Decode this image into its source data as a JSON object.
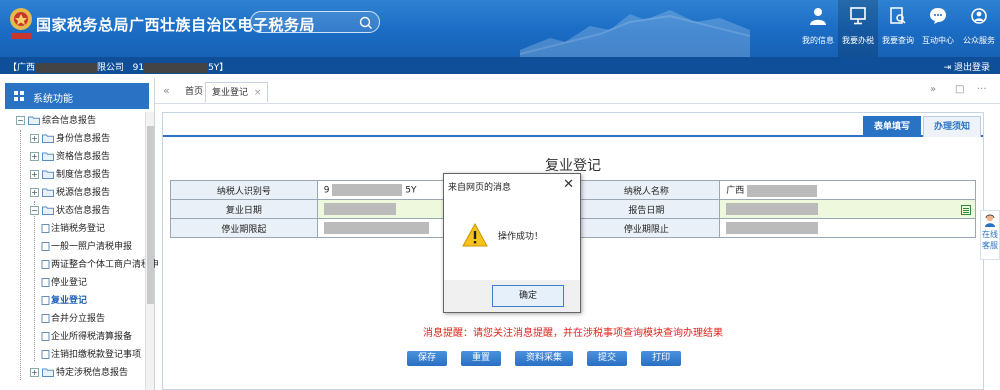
{
  "header": {
    "site_title": "国家税务总局广西壮族自治区电子税务局",
    "search_placeholder": "",
    "nav": [
      {
        "label": "我的信息",
        "icon": "user-icon"
      },
      {
        "label": "我要办税",
        "icon": "monitor-icon"
      },
      {
        "label": "我要查询",
        "icon": "query-icon"
      },
      {
        "label": "互动中心",
        "icon": "chat-icon"
      },
      {
        "label": "公众服务",
        "icon": "service-icon"
      }
    ]
  },
  "company_bar": {
    "prefix": "【广西",
    "company_suffix": "限公司",
    "id_prefix": "91",
    "id_suffix": "5Y】",
    "logout": "退出登录"
  },
  "sidebar": {
    "title": "系统功能",
    "tree": [
      {
        "label": "综合信息报告",
        "level": 1,
        "toggle": "−"
      },
      {
        "label": "身份信息报告",
        "level": 2,
        "toggle": "+"
      },
      {
        "label": "资格信息报告",
        "level": 2,
        "toggle": "+"
      },
      {
        "label": "制度信息报告",
        "level": 2,
        "toggle": "+"
      },
      {
        "label": "税源信息报告",
        "level": 2,
        "toggle": "+"
      },
      {
        "label": "状态信息报告",
        "level": 2,
        "toggle": "−"
      },
      {
        "label": "注销税务登记",
        "level": 3
      },
      {
        "label": "一般一照户清税申报",
        "level": 3
      },
      {
        "label": "两证整合个体工商户清税申",
        "level": 3
      },
      {
        "label": "停业登记",
        "level": 3
      },
      {
        "label": "复业登记",
        "level": 3,
        "selected": true
      },
      {
        "label": "合并分立报告",
        "level": 3
      },
      {
        "label": "企业所得税清算报备",
        "level": 3
      },
      {
        "label": "注销扣缴税款登记事项",
        "level": 3
      },
      {
        "label": "特定涉税信息报告",
        "level": 2,
        "toggle": "+"
      }
    ]
  },
  "tabs": {
    "back_symbol": "«",
    "home": "首页",
    "current": "复业登记",
    "close": "×",
    "forward_symbol": "»",
    "window_symbol": "□",
    "more_symbol": "···"
  },
  "panel": {
    "tab_fill": "表单填写",
    "tab_guide": "办理须知",
    "form_title": "复业登记",
    "rows": [
      {
        "label_left": "纳税人识别号",
        "value_left_prefix": "9",
        "value_left_suffix": "5Y",
        "label_right": "纳税人名称",
        "value_right_prefix": "广西"
      },
      {
        "label_left": "复业日期",
        "label_right": "报告日期"
      },
      {
        "label_left": "停业期限起",
        "label_right": "停业期限止"
      }
    ],
    "notice": "消息提醒：请您关注消息提醒，并在涉税事项查询模块查询办理结果",
    "buttons": [
      "保存",
      "重置",
      "资料采集",
      "提交",
      "打印"
    ]
  },
  "dialog": {
    "title": "来自网页的消息",
    "close": "✕",
    "message": "操作成功！",
    "ok_label": "确定"
  },
  "online_service": {
    "label1": "在线",
    "label2": "客服"
  },
  "colors": {
    "header_blue": "#1a6cc4",
    "company_bar": "#0f4f9a",
    "accent": "#2a73c4",
    "notice_red": "#e0261b",
    "field_green": "#eef8dc"
  }
}
